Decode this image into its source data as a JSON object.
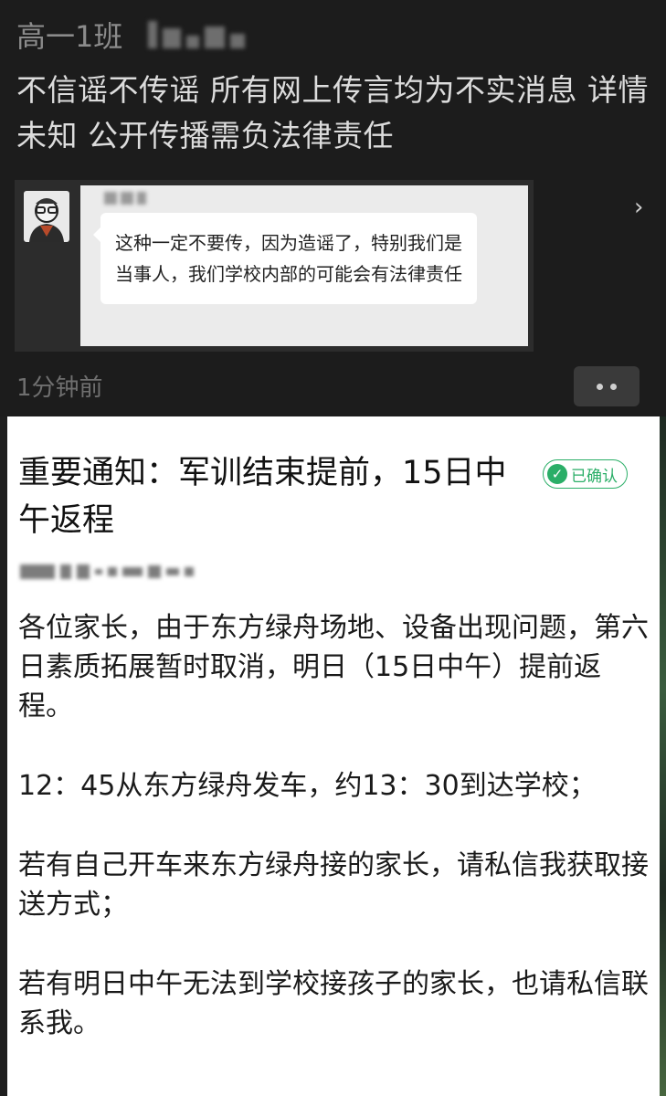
{
  "moments": {
    "class_name": "高一1班",
    "post_text": "不信谣不传谣 所有网上传言均为不实消息 详情未知 公开传播需负法律责任",
    "shared_chat": {
      "message": "这种一定不要传，因为造谣了，特别我们是当事人，我们学校内部的可能会有法律责任"
    },
    "time": "1分钟前"
  },
  "notice": {
    "title": "重要通知：军训结束提前，15日中午返程",
    "badge": "已确认",
    "paragraphs": [
      "各位家长，由于东方绿舟场地、设备出现问题，第六日素质拓展暂时取消，明日（15日中午）提前返程。",
      "12：45从东方绿舟发车，约13：30到达学校；",
      "若有自己开车来东方绿舟接的家长，请私信我获取接送方式；",
      "若有明日中午无法到学校接孩子的家长，也请私信联系我。"
    ]
  },
  "colors": {
    "dark_bg": "#1c1c1c",
    "card_bg": "#2c2c2c",
    "confirm_green": "#2aae67"
  },
  "icons": [
    "avatar-cartoon-icon",
    "chevron-right-icon",
    "more-dots-icon",
    "check-circle-icon"
  ]
}
